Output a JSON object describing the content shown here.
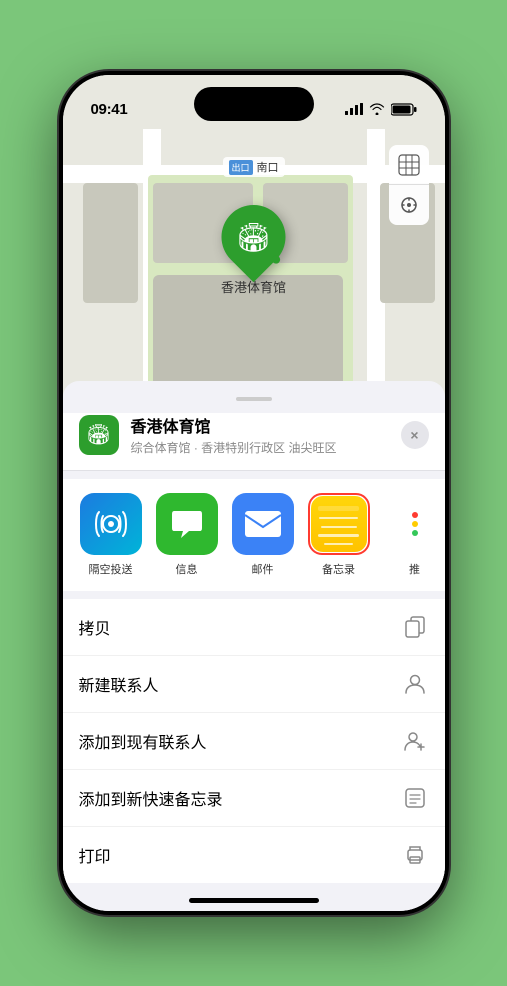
{
  "status": {
    "time": "09:41",
    "location_arrow": "▲"
  },
  "map": {
    "label_badge": "出口",
    "label_text": "南口",
    "pin_label": "香港体育馆",
    "ctrl_map": "🗺",
    "ctrl_location": "↖"
  },
  "location_card": {
    "name": "香港体育馆",
    "subtitle": "综合体育馆 · 香港特别行政区 油尖旺区",
    "close_label": "×"
  },
  "share_items": [
    {
      "id": "airdrop",
      "label": "隔空投送"
    },
    {
      "id": "messages",
      "label": "信息"
    },
    {
      "id": "mail",
      "label": "邮件"
    },
    {
      "id": "notes",
      "label": "备忘录"
    },
    {
      "id": "more",
      "label": "推"
    }
  ],
  "actions": [
    {
      "label": "拷贝",
      "icon": "copy"
    },
    {
      "label": "新建联系人",
      "icon": "person"
    },
    {
      "label": "添加到现有联系人",
      "icon": "person-add"
    },
    {
      "label": "添加到新快速备忘录",
      "icon": "note"
    },
    {
      "label": "打印",
      "icon": "print"
    }
  ]
}
